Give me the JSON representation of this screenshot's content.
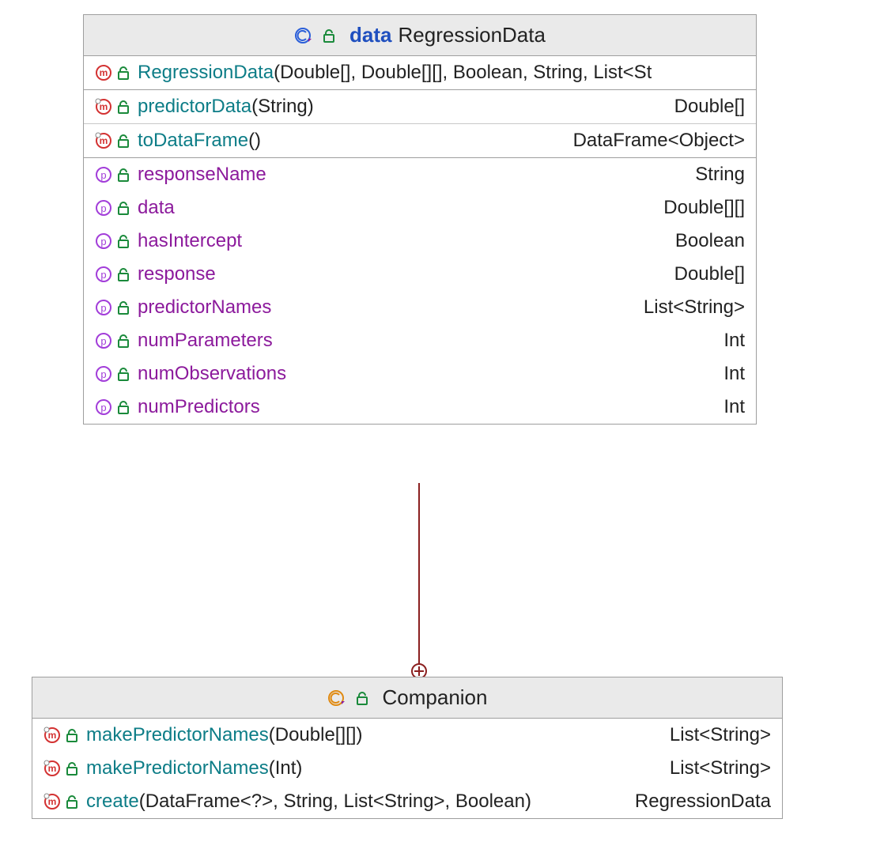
{
  "box1": {
    "header": {
      "keyword": "data",
      "name": "RegressionData"
    },
    "constructors": [
      {
        "name": "RegressionData",
        "params": "(Double[], Double[][], Boolean, String, List<St",
        "ret": ""
      }
    ],
    "methods": [
      {
        "name": "predictorData",
        "params": "(String)",
        "ret": "Double[]"
      },
      {
        "name": "toDataFrame",
        "params": "()",
        "ret": "DataFrame<Object>"
      }
    ],
    "properties": [
      {
        "name": "responseName",
        "ret": "String"
      },
      {
        "name": "data",
        "ret": "Double[][]"
      },
      {
        "name": "hasIntercept",
        "ret": "Boolean"
      },
      {
        "name": "response",
        "ret": "Double[]"
      },
      {
        "name": "predictorNames",
        "ret": "List<String>"
      },
      {
        "name": "numParameters",
        "ret": "Int"
      },
      {
        "name": "numObservations",
        "ret": "Int"
      },
      {
        "name": "numPredictors",
        "ret": "Int"
      }
    ]
  },
  "box2": {
    "header": {
      "name": "Companion"
    },
    "methods": [
      {
        "name": "makePredictorNames",
        "params": "(Double[][])",
        "ret": "List<String>"
      },
      {
        "name": "makePredictorNames",
        "params": "(Int)",
        "ret": "List<String>"
      },
      {
        "name": "create",
        "params": "(DataFrame<?>, String, List<String>, Boolean)",
        "ret": "RegressionData"
      }
    ]
  }
}
